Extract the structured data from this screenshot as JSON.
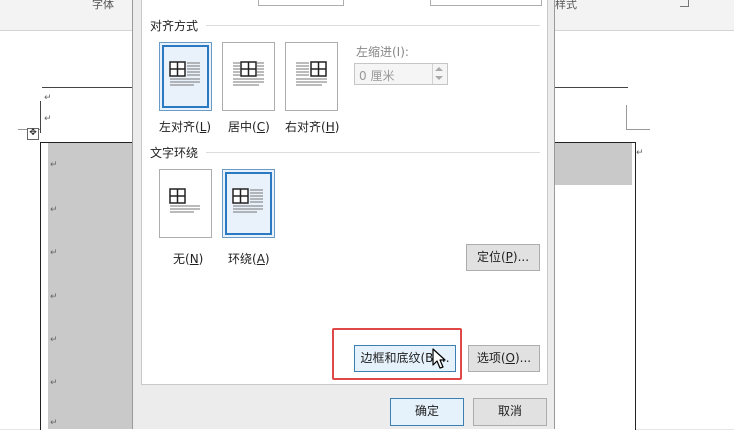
{
  "ribbon": {
    "group_font": "字体",
    "group_style": "样式"
  },
  "dialog": {
    "alignment": {
      "title": "对齐方式",
      "options": [
        {
          "label": "左对齐(",
          "key": "L",
          "end": ")"
        },
        {
          "label": "居中(",
          "key": "C",
          "end": ")"
        },
        {
          "label": "右对齐(",
          "key": "H",
          "end": ")"
        }
      ],
      "selected": "左对齐"
    },
    "indent": {
      "label": "左缩进(I):",
      "value": "0 厘米"
    },
    "wrap": {
      "title": "文字环绕",
      "options": [
        {
          "label": "无(",
          "key": "N",
          "end": ")"
        },
        {
          "label": "环绕(",
          "key": "A",
          "end": ")"
        }
      ],
      "selected": "环绕"
    },
    "buttons": {
      "position": {
        "label": "定位(",
        "key": "P",
        "end": ")..."
      },
      "borders": {
        "label": "边框和底纹(B)..."
      },
      "options": {
        "label": "选项(",
        "key": "O",
        "end": ")..."
      },
      "ok": "确定",
      "cancel": "取消"
    }
  },
  "doc": {
    "paragraph_mark": "↵",
    "table_move_handle": "✥"
  },
  "colors": {
    "highlight": "#e04747",
    "accent": "#2b79c2"
  }
}
